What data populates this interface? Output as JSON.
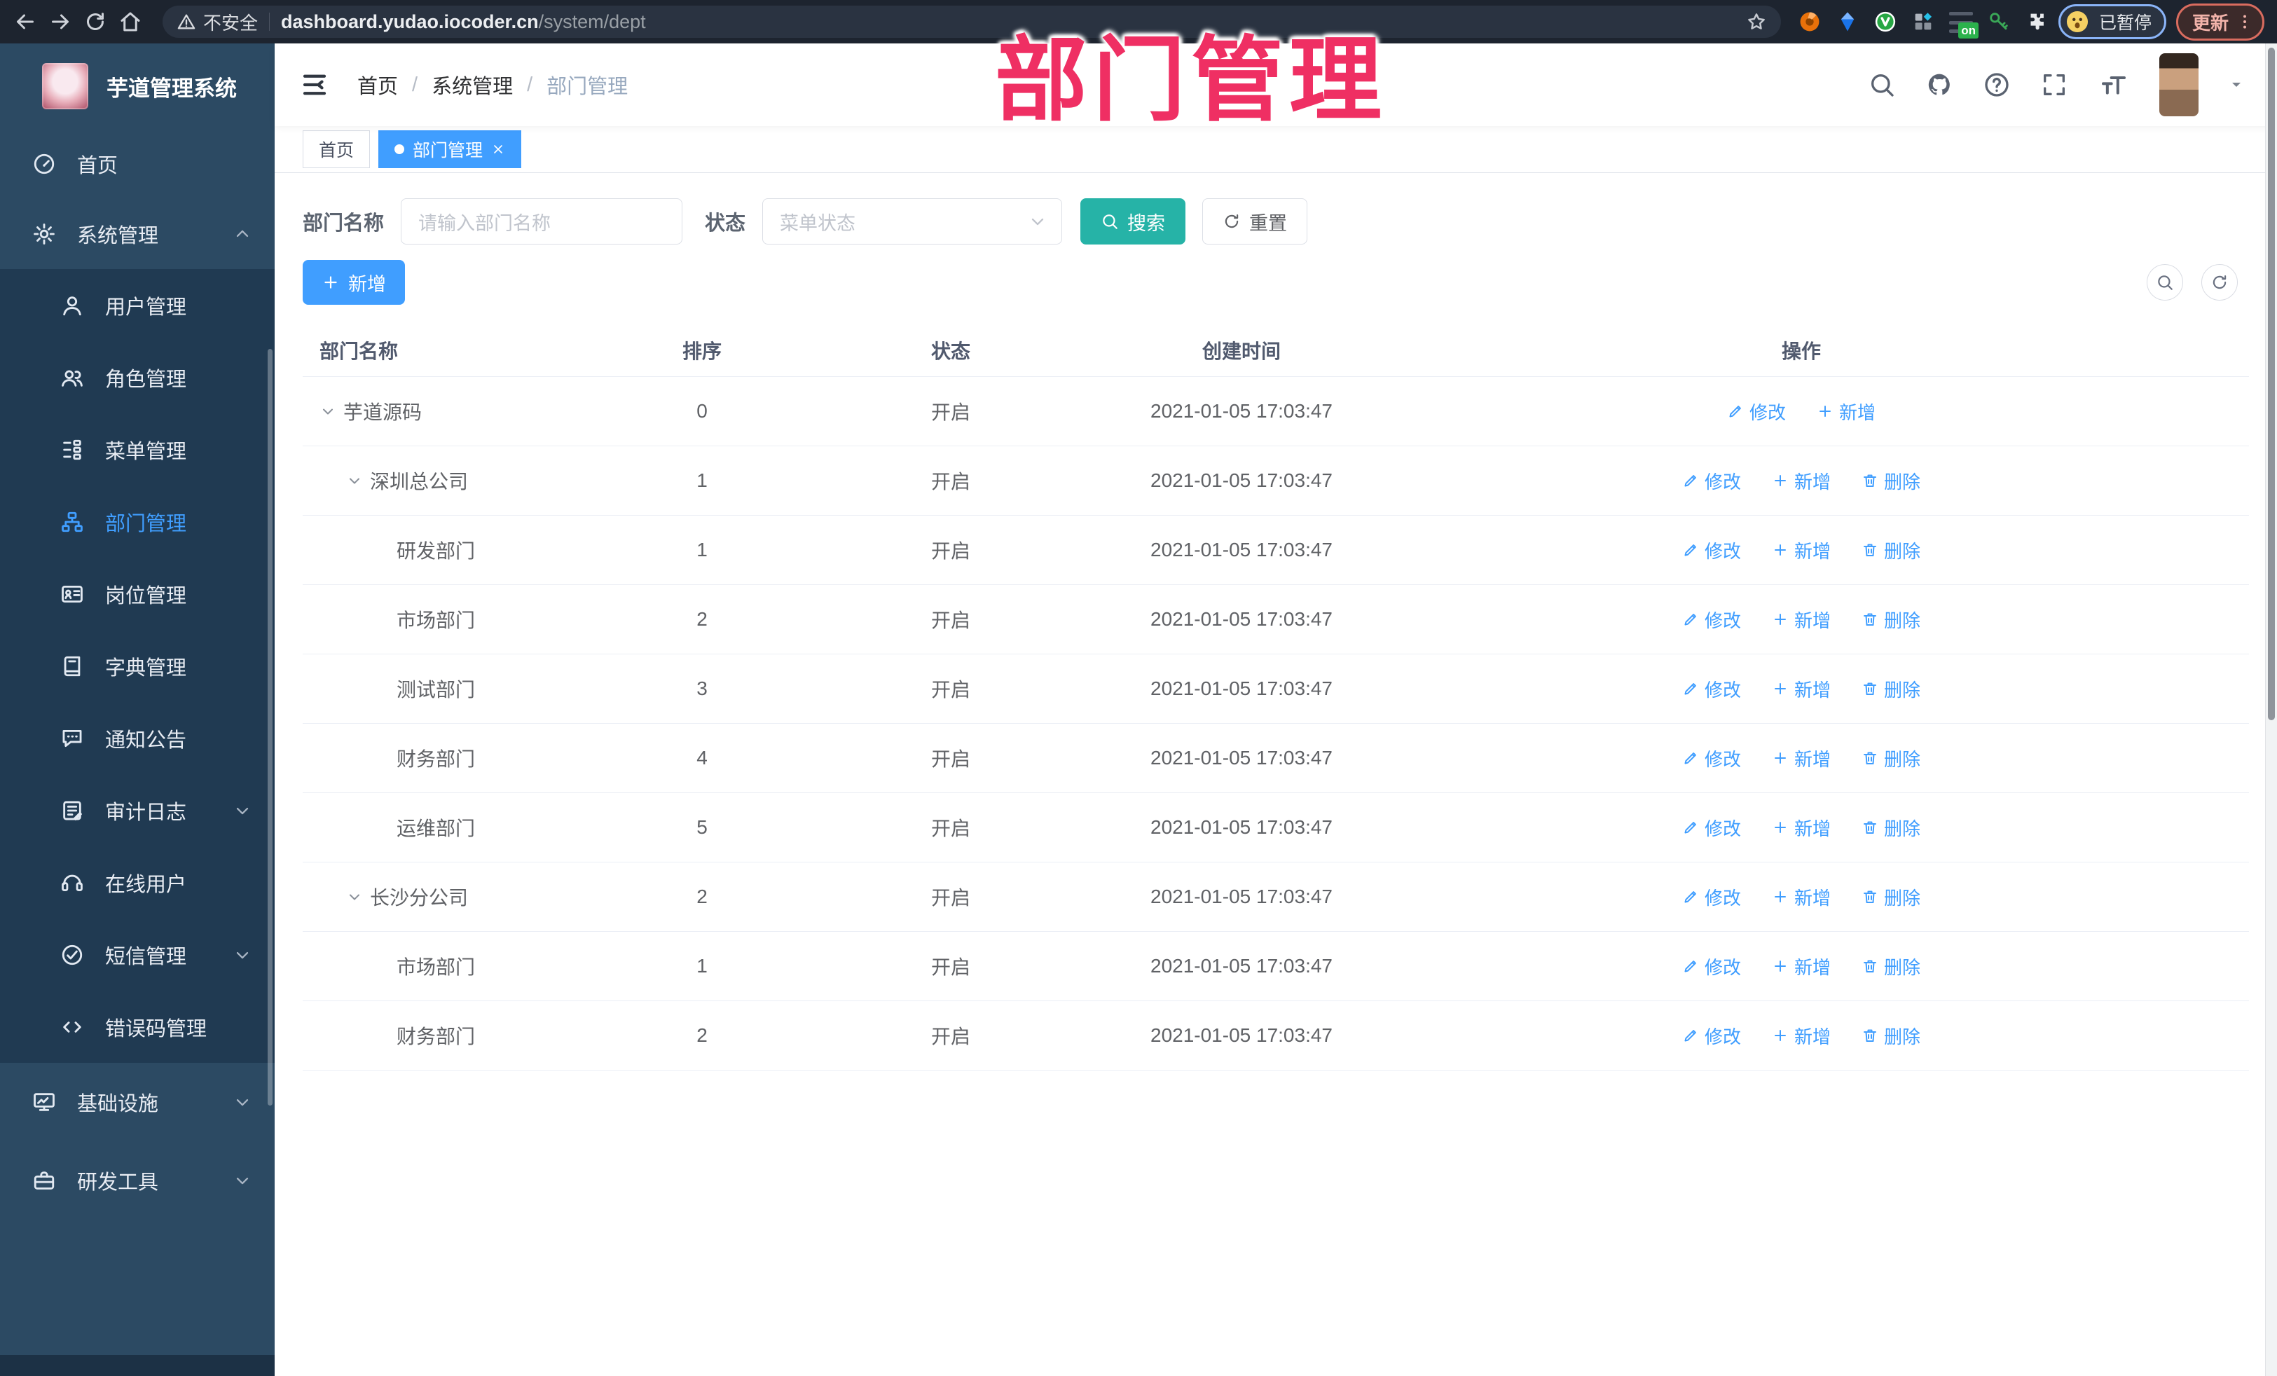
{
  "browser": {
    "security_label": "不安全",
    "url_host": "dashboard.yudao.iocoder.cn",
    "url_path": "/system/dept",
    "ext_badge": "on",
    "profile_badge": "已暂停",
    "update_button": "更新"
  },
  "overlay_title": "部门管理",
  "sidebar": {
    "app_title": "芋道管理系统",
    "items": [
      {
        "key": "dashboard",
        "label": "首页",
        "icon": "dashboard-icon",
        "level": 0
      },
      {
        "key": "system",
        "label": "系统管理",
        "icon": "gear-icon",
        "level": 0,
        "chevron": "up"
      },
      {
        "key": "user",
        "label": "用户管理",
        "icon": "user-icon",
        "level": 1
      },
      {
        "key": "role",
        "label": "角色管理",
        "icon": "users-icon",
        "level": 1
      },
      {
        "key": "menu",
        "label": "菜单管理",
        "icon": "tree-list-icon",
        "level": 1
      },
      {
        "key": "dept",
        "label": "部门管理",
        "icon": "org-chart-icon",
        "level": 1,
        "active": true
      },
      {
        "key": "post",
        "label": "岗位管理",
        "icon": "id-card-icon",
        "level": 1
      },
      {
        "key": "dict",
        "label": "字典管理",
        "icon": "book-icon",
        "level": 1
      },
      {
        "key": "notice",
        "label": "通知公告",
        "icon": "message-icon",
        "level": 1
      },
      {
        "key": "audit-log",
        "label": "审计日志",
        "icon": "log-icon",
        "level": 1,
        "chevron": "down"
      },
      {
        "key": "online-user",
        "label": "在线用户",
        "icon": "headset-icon",
        "level": 1
      },
      {
        "key": "sms",
        "label": "短信管理",
        "icon": "check-circle-icon",
        "level": 1,
        "chevron": "down"
      },
      {
        "key": "error-code",
        "label": "错误码管理",
        "icon": "code-icon",
        "level": 1
      },
      {
        "key": "infra",
        "label": "基础设施",
        "icon": "monitor-icon",
        "level": 0,
        "chevron": "down",
        "bottom": true
      },
      {
        "key": "devtool",
        "label": "研发工具",
        "icon": "toolbox-icon",
        "level": 0,
        "chevron": "down",
        "bottom": true
      }
    ]
  },
  "header": {
    "breadcrumb": [
      "首页",
      "系统管理",
      "部门管理"
    ]
  },
  "tabs": [
    {
      "label": "首页",
      "active": false
    },
    {
      "label": "部门管理",
      "active": true,
      "closable": true
    }
  ],
  "filters": {
    "dept_label": "部门名称",
    "dept_placeholder": "请输入部门名称",
    "status_label": "状态",
    "status_placeholder": "菜单状态",
    "search_button": "搜索",
    "reset_button": "重置"
  },
  "toolbar": {
    "add_button": "新增"
  },
  "table": {
    "columns": [
      "部门名称",
      "排序",
      "状态",
      "创建时间",
      "操作"
    ],
    "rows": [
      {
        "name": "芋道源码",
        "indent": 0,
        "expandable": true,
        "sort": "0",
        "status": "开启",
        "created": "2021-01-05 17:03:47",
        "actions": [
          {
            "label": "修改",
            "icon": "edit-icon",
            "name": "edit-link"
          },
          {
            "label": "新增",
            "icon": "plus-icon",
            "name": "add-link"
          }
        ]
      },
      {
        "name": "深圳总公司",
        "indent": 1,
        "expandable": true,
        "sort": "1",
        "status": "开启",
        "created": "2021-01-05 17:03:47",
        "actions": [
          {
            "label": "修改",
            "icon": "edit-icon",
            "name": "edit-link"
          },
          {
            "label": "新增",
            "icon": "plus-icon",
            "name": "add-link"
          },
          {
            "label": "删除",
            "icon": "trash-icon",
            "name": "delete-link"
          }
        ]
      },
      {
        "name": "研发部门",
        "indent": 2,
        "expandable": false,
        "sort": "1",
        "status": "开启",
        "created": "2021-01-05 17:03:47",
        "actions": [
          {
            "label": "修改",
            "icon": "edit-icon",
            "name": "edit-link"
          },
          {
            "label": "新增",
            "icon": "plus-icon",
            "name": "add-link"
          },
          {
            "label": "删除",
            "icon": "trash-icon",
            "name": "delete-link"
          }
        ]
      },
      {
        "name": "市场部门",
        "indent": 2,
        "expandable": false,
        "sort": "2",
        "status": "开启",
        "created": "2021-01-05 17:03:47",
        "actions": [
          {
            "label": "修改",
            "icon": "edit-icon",
            "name": "edit-link"
          },
          {
            "label": "新增",
            "icon": "plus-icon",
            "name": "add-link"
          },
          {
            "label": "删除",
            "icon": "trash-icon",
            "name": "delete-link"
          }
        ]
      },
      {
        "name": "测试部门",
        "indent": 2,
        "expandable": false,
        "sort": "3",
        "status": "开启",
        "created": "2021-01-05 17:03:47",
        "actions": [
          {
            "label": "修改",
            "icon": "edit-icon",
            "name": "edit-link"
          },
          {
            "label": "新增",
            "icon": "plus-icon",
            "name": "add-link"
          },
          {
            "label": "删除",
            "icon": "trash-icon",
            "name": "delete-link"
          }
        ]
      },
      {
        "name": "财务部门",
        "indent": 2,
        "expandable": false,
        "sort": "4",
        "status": "开启",
        "created": "2021-01-05 17:03:47",
        "actions": [
          {
            "label": "修改",
            "icon": "edit-icon",
            "name": "edit-link"
          },
          {
            "label": "新增",
            "icon": "plus-icon",
            "name": "add-link"
          },
          {
            "label": "删除",
            "icon": "trash-icon",
            "name": "delete-link"
          }
        ]
      },
      {
        "name": "运维部门",
        "indent": 2,
        "expandable": false,
        "sort": "5",
        "status": "开启",
        "created": "2021-01-05 17:03:47",
        "actions": [
          {
            "label": "修改",
            "icon": "edit-icon",
            "name": "edit-link"
          },
          {
            "label": "新增",
            "icon": "plus-icon",
            "name": "add-link"
          },
          {
            "label": "删除",
            "icon": "trash-icon",
            "name": "delete-link"
          }
        ]
      },
      {
        "name": "长沙分公司",
        "indent": 1,
        "expandable": true,
        "sort": "2",
        "status": "开启",
        "created": "2021-01-05 17:03:47",
        "actions": [
          {
            "label": "修改",
            "icon": "edit-icon",
            "name": "edit-link"
          },
          {
            "label": "新增",
            "icon": "plus-icon",
            "name": "add-link"
          },
          {
            "label": "删除",
            "icon": "trash-icon",
            "name": "delete-link"
          }
        ]
      },
      {
        "name": "市场部门",
        "indent": 2,
        "expandable": false,
        "sort": "1",
        "status": "开启",
        "created": "2021-01-05 17:03:47",
        "actions": [
          {
            "label": "修改",
            "icon": "edit-icon",
            "name": "edit-link"
          },
          {
            "label": "新增",
            "icon": "plus-icon",
            "name": "add-link"
          },
          {
            "label": "删除",
            "icon": "trash-icon",
            "name": "delete-link"
          }
        ]
      },
      {
        "name": "财务部门",
        "indent": 2,
        "expandable": false,
        "sort": "2",
        "status": "开启",
        "created": "2021-01-05 17:03:47",
        "actions": [
          {
            "label": "修改",
            "icon": "edit-icon",
            "name": "edit-link"
          },
          {
            "label": "新增",
            "icon": "plus-icon",
            "name": "add-link"
          },
          {
            "label": "删除",
            "icon": "trash-icon",
            "name": "delete-link"
          }
        ]
      }
    ]
  },
  "colors": {
    "primary": "#409eff",
    "search_teal": "#26b3a7",
    "overlay_pink": "#ef2f63",
    "sidebar_bg": "#2c4a63",
    "submenu_bg": "#203a52"
  }
}
